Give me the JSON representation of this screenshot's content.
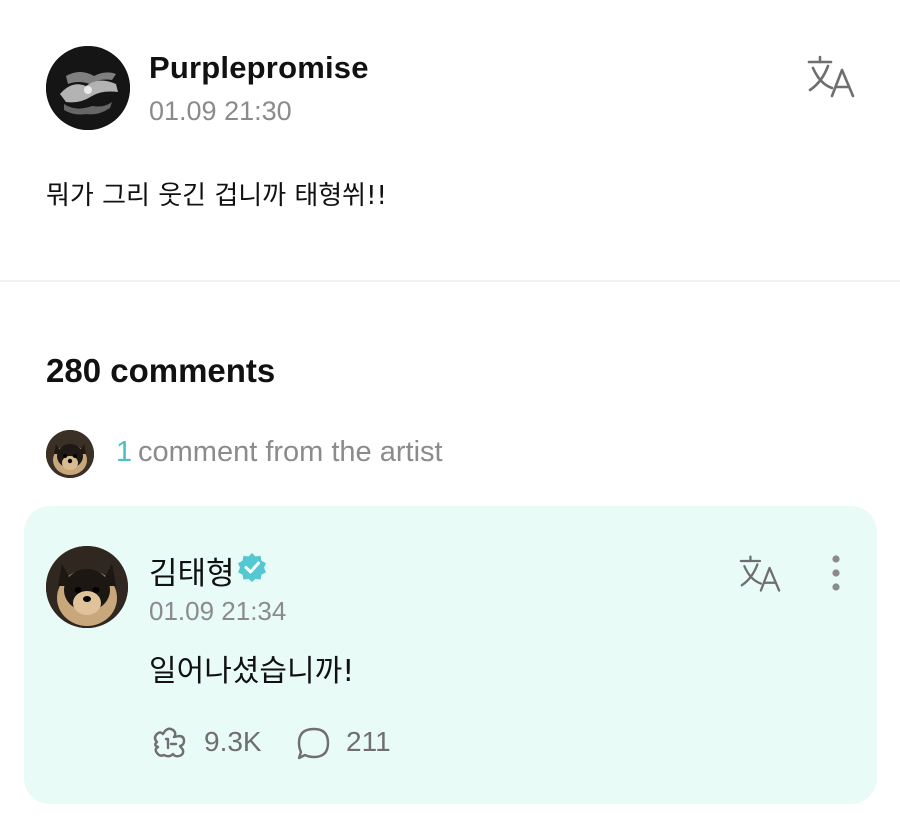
{
  "post": {
    "author": "Purplepromise",
    "timestamp": "01.09 21:30",
    "body": "뭐가 그리 웃긴 겁니까 태형쒸!!",
    "translate_icon": "translate-icon"
  },
  "comments_section": {
    "count_label": "280 comments",
    "artist_summary": {
      "count": "1",
      "text": "comment from the artist"
    }
  },
  "artist_comment": {
    "author": "김태형",
    "verified": true,
    "timestamp": "01.09 21:34",
    "text": "일어나셨습니까!",
    "likes": "9.3K",
    "replies": "211",
    "icons": [
      "translate-icon",
      "more-vertical-icon",
      "like-icon",
      "reply-icon",
      "verified-badge-icon"
    ]
  },
  "colors": {
    "accent": "#4ac0c8",
    "card_background": "#e9fbf7",
    "muted_text": "#8b8b8b",
    "verified": "#54c8d0"
  }
}
